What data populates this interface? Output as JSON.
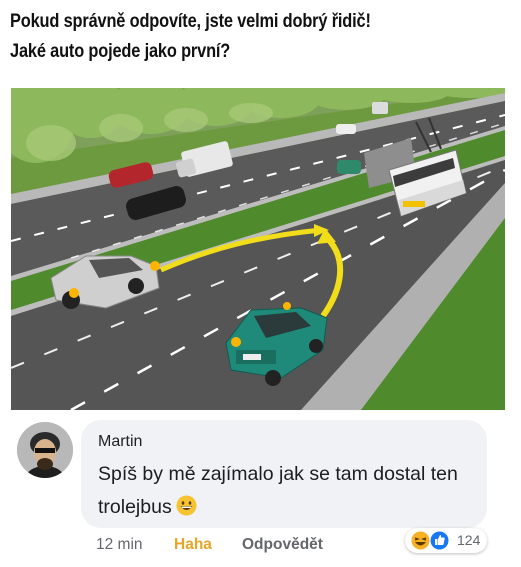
{
  "post": {
    "headline_line1": "Pokud správně odpovíte, jste velmi dobrý řidič!",
    "headline_line2": "Jaké auto pojede jako první?"
  },
  "comment": {
    "author": "Martin",
    "text": "Spíš by mě zajímalo jak se tam dostal ten trolejbus",
    "time": "12 min",
    "reaction_label": "Haha",
    "reply_label": "Odpovědět",
    "reaction_count": "124",
    "reaction_icons": [
      "haha-icon",
      "like-icon"
    ]
  },
  "colors": {
    "haha_accent": "#e5a526",
    "bubble_bg": "#f0f2f5",
    "meta_text": "#65676b",
    "like_blue": "#1877f2"
  }
}
